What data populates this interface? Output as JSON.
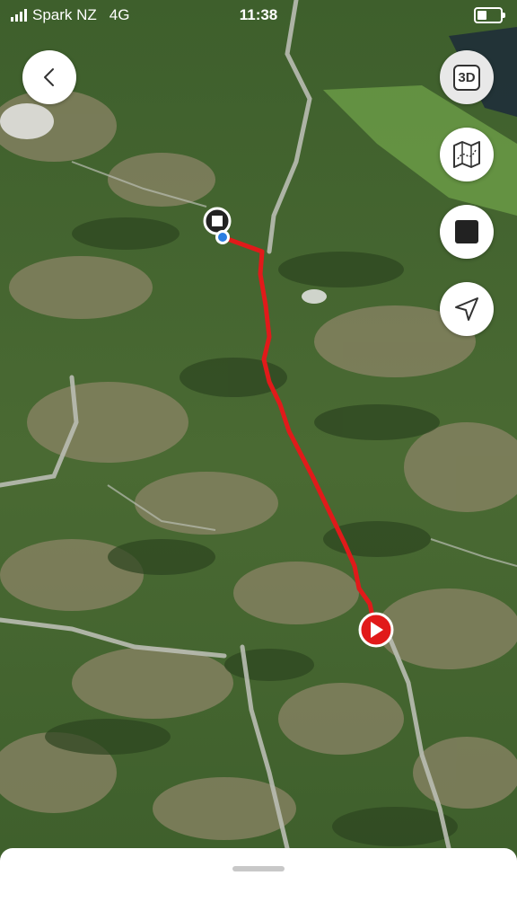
{
  "status_bar": {
    "carrier": "Spark NZ",
    "network": "4G",
    "time": "11:38"
  },
  "map": {
    "type": "3d-satellite-terrain",
    "route_color": "#e11a1a",
    "start_marker": "play-icon",
    "end_marker": "stop-square-icon",
    "current_location_marker": "location-dot-icon"
  },
  "controls": {
    "back": "chevron-left-icon",
    "toggle_3d_label": "3D",
    "map_layers": "folded-map-icon",
    "stop": "stop-icon",
    "locate": "navigation-arrow-icon"
  },
  "bottom_sheet": {
    "handle": "drag-handle"
  }
}
